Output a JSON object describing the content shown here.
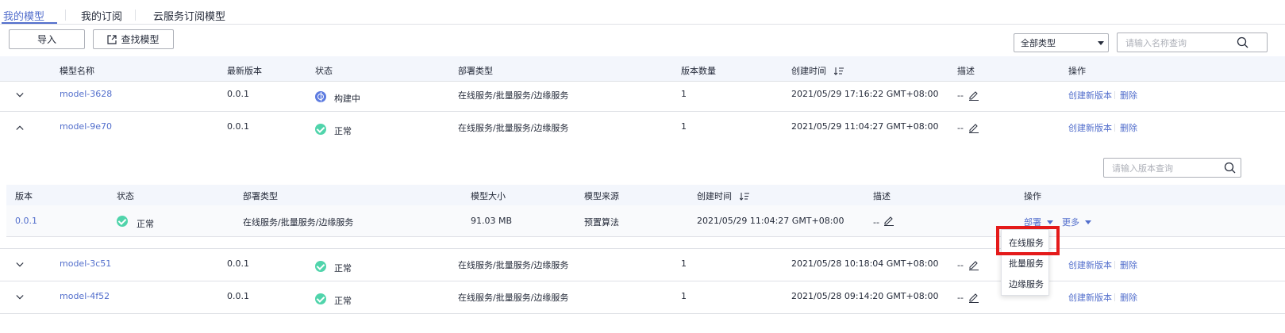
{
  "tabs": [
    {
      "label": "我的模型",
      "active": true
    },
    {
      "label": "我的订阅",
      "active": false
    },
    {
      "label": "云服务订阅模型",
      "active": false
    }
  ],
  "toolbar": {
    "import_label": "导入",
    "find_model_label": "查找模型",
    "type_select_value": "全部类型",
    "search_placeholder": "请输入名称查询"
  },
  "table": {
    "columns": [
      "模型名称",
      "最新版本",
      "状态",
      "部署类型",
      "版本数量",
      "创建时间",
      "描述",
      "操作"
    ],
    "rows": [
      {
        "name": "model-3628",
        "version": "0.0.1",
        "status": "构建中",
        "deploy_type": "在线服务/批量服务/边缘服务",
        "count": "1",
        "created": "2021/05/29 17:16:22 GMT+08:00",
        "desc": "--",
        "op_create": "创建新版本",
        "op_delete": "删除"
      },
      {
        "name": "model-9e70",
        "version": "0.0.1",
        "status": "正常",
        "deploy_type": "在线服务/批量服务/边缘服务",
        "count": "1",
        "created": "2021/05/29 11:04:27 GMT+08:00",
        "desc": "--",
        "op_create": "创建新版本",
        "op_delete": "删除"
      },
      {
        "name": "model-3c51",
        "version": "0.0.1",
        "status": "正常",
        "deploy_type": "在线服务/批量服务/边缘服务",
        "count": "1",
        "created": "2021/05/28 10:18:04 GMT+08:00",
        "desc": "--",
        "op_create": "创建新版本",
        "op_delete": "删除"
      },
      {
        "name": "model-4f52",
        "version": "0.0.1",
        "status": "正常",
        "deploy_type": "在线服务/批量服务/边缘服务",
        "count": "1",
        "created": "2021/05/28 09:14:20 GMT+08:00",
        "desc": "--",
        "op_create": "创建新版本",
        "op_delete": "删除"
      }
    ]
  },
  "versions": {
    "search_placeholder": "请输入版本查询",
    "columns": [
      "版本",
      "状态",
      "部署类型",
      "模型大小",
      "模型来源",
      "创建时间",
      "描述",
      "操作"
    ],
    "row": {
      "version": "0.0.1",
      "status": "正常",
      "deploy_type": "在线服务/批量服务/边缘服务",
      "size": "91.03 MB",
      "source": "预置算法",
      "created": "2021/05/29 11:04:27 GMT+08:00",
      "desc": "--",
      "op_deploy": "部署",
      "op_more": "更多"
    }
  },
  "deploy_menu": {
    "items": [
      "在线服务",
      "批量服务",
      "边缘服务"
    ]
  },
  "colors": {
    "accent": "#526ecc",
    "ok": "#50d4ab",
    "building": "#5e7ce0",
    "highlight": "#e41a1a"
  },
  "icons": [
    "chevron-down-icon",
    "chevron-up-icon",
    "check-circle-icon",
    "building-status-icon",
    "edit-pencil-icon",
    "sort-icon",
    "search-icon",
    "external-link-icon",
    "caret-down-icon"
  ]
}
